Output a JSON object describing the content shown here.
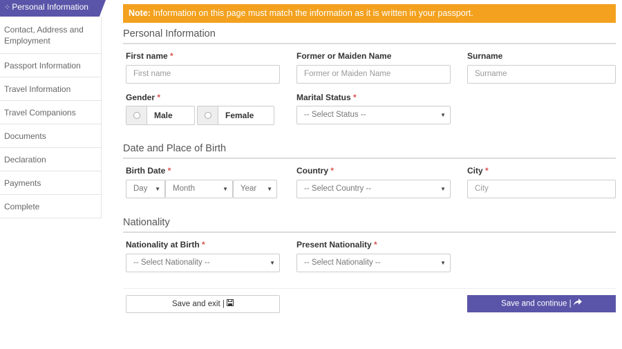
{
  "sidebar": {
    "active": {
      "icon": "dots-icon",
      "label": "Personal Information"
    },
    "items": [
      {
        "label": "Contact, Address and Employment"
      },
      {
        "label": "Passport Information"
      },
      {
        "label": "Travel Information"
      },
      {
        "label": "Travel Companions"
      },
      {
        "label": "Documents"
      },
      {
        "label": "Declaration"
      },
      {
        "label": "Payments"
      },
      {
        "label": "Complete"
      }
    ]
  },
  "note": {
    "strong": "Note:",
    "text": " Information on this page must match the information as it is written in your passport."
  },
  "sections": {
    "personal": "Personal Information",
    "birth": "Date and Place of Birth",
    "nationality": "Nationality"
  },
  "fields": {
    "first_name": {
      "label": "First name",
      "required": "*",
      "placeholder": "First name"
    },
    "maiden_name": {
      "label": "Former or Maiden Name",
      "placeholder": "Former or Maiden Name"
    },
    "surname": {
      "label": "Surname",
      "placeholder": "Surname"
    },
    "gender": {
      "label": "Gender",
      "required": "*",
      "options": [
        "Male",
        "Female"
      ]
    },
    "marital": {
      "label": "Marital Status",
      "required": "*",
      "value": "-- Select Status --"
    },
    "birth_date": {
      "label": "Birth Date",
      "required": "*",
      "day": "Day",
      "month": "Month",
      "year": "Year"
    },
    "country": {
      "label": "Country",
      "required": "*",
      "value": "-- Select Country --"
    },
    "city": {
      "label": "City",
      "required": "*",
      "placeholder": "City"
    },
    "nat_birth": {
      "label": "Nationality at Birth",
      "required": "*",
      "value": "-- Select Nationality --"
    },
    "nat_present": {
      "label": "Present Nationality",
      "required": "*",
      "value": "-- Select Nationality --"
    }
  },
  "buttons": {
    "save_exit": "Save and exit |",
    "save_exit_icon": "floppy-disk-icon",
    "save_continue": "Save and continue |",
    "save_continue_icon": "share-arrow-icon"
  }
}
